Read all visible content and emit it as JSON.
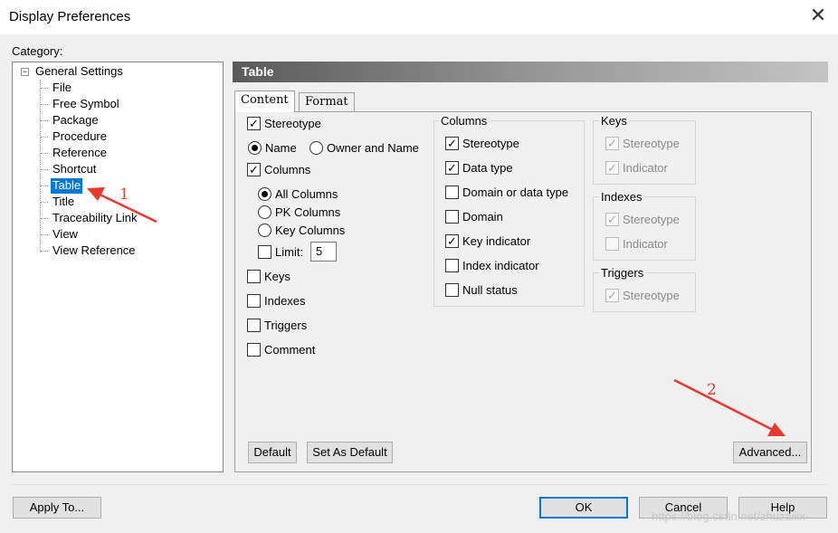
{
  "window": {
    "title": "Display Preferences",
    "close_glyph": "✕"
  },
  "category_label": "Category:",
  "tree": {
    "root": "General Settings",
    "expander": "−",
    "items": [
      "File",
      "Free Symbol",
      "Package",
      "Procedure",
      "Reference",
      "Shortcut",
      "Table",
      "Title",
      "Traceability Link",
      "View",
      "View Reference"
    ],
    "selected": "Table"
  },
  "pane_title": "Table",
  "tabs": [
    {
      "label": "Content",
      "active": true
    },
    {
      "label": "Format",
      "active": false
    }
  ],
  "content": {
    "stereotype": {
      "label": "Stereotype",
      "checked": true
    },
    "name_radio": {
      "label": "Name",
      "selected": true
    },
    "owner_name_radio": {
      "label": "Owner and Name",
      "selected": false
    },
    "columns": {
      "label": "Columns",
      "checked": true
    },
    "all_columns": {
      "label": "All Columns",
      "selected": true
    },
    "pk_columns": {
      "label": "PK Columns",
      "selected": false
    },
    "key_columns": {
      "label": "Key Columns",
      "selected": false
    },
    "limit": {
      "label": "Limit:",
      "checked": false,
      "value": "5"
    },
    "keys": {
      "label": "Keys",
      "checked": false
    },
    "indexes": {
      "label": "Indexes",
      "checked": false
    },
    "triggers": {
      "label": "Triggers",
      "checked": false
    },
    "comment": {
      "label": "Comment",
      "checked": false
    }
  },
  "columns_group": {
    "title": "Columns",
    "items": [
      {
        "label": "Stereotype",
        "checked": true
      },
      {
        "label": "Data type",
        "checked": true
      },
      {
        "label": "Domain or data type",
        "checked": false
      },
      {
        "label": "Domain",
        "checked": false
      },
      {
        "label": "Key indicator",
        "checked": true
      },
      {
        "label": "Index indicator",
        "checked": false
      },
      {
        "label": "Null status",
        "checked": false
      }
    ]
  },
  "keys_group": {
    "title": "Keys",
    "items": [
      {
        "label": "Stereotype",
        "checked": true
      },
      {
        "label": "Indicator",
        "checked": true
      }
    ]
  },
  "indexes_group": {
    "title": "Indexes",
    "items": [
      {
        "label": "Stereotype",
        "checked": true
      },
      {
        "label": "Indicator",
        "checked": false
      }
    ]
  },
  "triggers_group": {
    "title": "Triggers",
    "items": [
      {
        "label": "Stereotype",
        "checked": true
      }
    ]
  },
  "buttons": {
    "default": "Default",
    "set_as_default": "Set As Default",
    "advanced": "Advanced...",
    "apply_to": "Apply To...",
    "ok": "OK",
    "cancel": "Cancel",
    "help": "Help"
  },
  "annotations": {
    "arrow1_label": "1",
    "arrow2_label": "2",
    "color": "#e8392f"
  },
  "watermark": "https://blog.csdn.net/zhuzaiiix",
  "check_glyph": "✓"
}
